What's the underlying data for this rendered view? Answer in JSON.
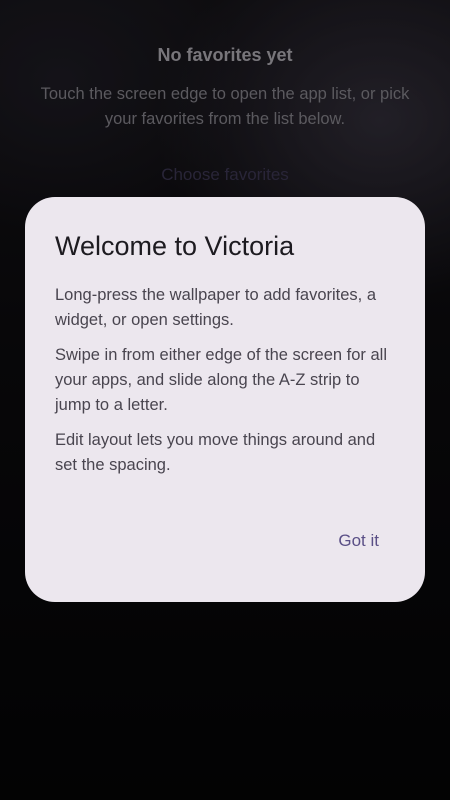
{
  "empty_state": {
    "title": "No favorites yet",
    "description": "Touch the screen edge to open the app list, or pick your favorites from the list below.",
    "choose_button": "Choose favorites"
  },
  "dialog": {
    "title": "Welcome to Victoria",
    "paragraphs": [
      "Long-press the wallpaper to add favorites, a widget, or open settings.",
      "Swipe in from either edge of the screen for all your apps, and slide along the A-Z strip to jump to a letter.",
      "Edit layout lets you move things around and set the spacing."
    ],
    "confirm_button": "Got it"
  },
  "colors": {
    "dialog_background": "#ece7ee",
    "accent": "#5a4f86",
    "screen_background": "#000000"
  }
}
